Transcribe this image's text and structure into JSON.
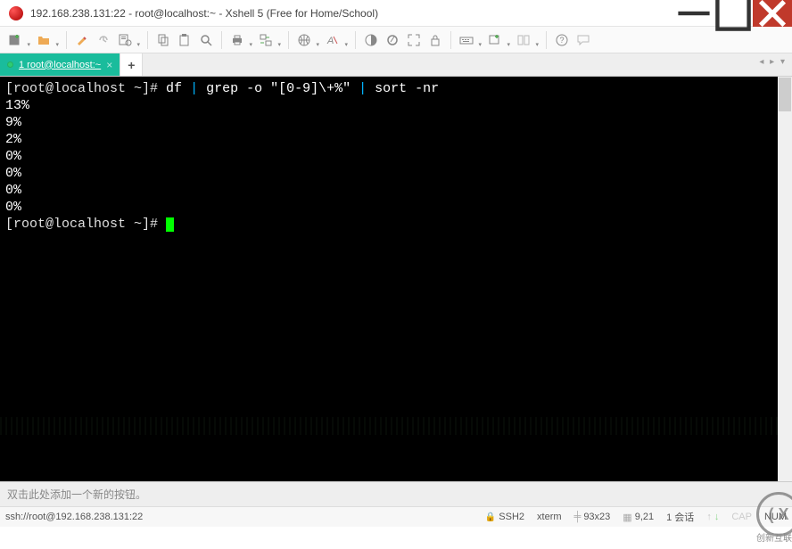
{
  "window": {
    "title": "192.168.238.131:22 - root@localhost:~ - Xshell 5 (Free for Home/School)"
  },
  "tabs": [
    {
      "label": "1 root@localhost:~",
      "active": true
    }
  ],
  "terminal": {
    "prompt": "[root@localhost ~]#",
    "command_parts": {
      "c1": "df ",
      "p1": "|",
      "c2": " grep -o \"[0-9]\\+%\" ",
      "p2": "|",
      "c3": " sort -nr"
    },
    "output": [
      "13%",
      "9%",
      "2%",
      "0%",
      "0%",
      "0%",
      "0%"
    ],
    "prompt2": "[root@localhost ~]#"
  },
  "buttonbar_hint": "双击此处添加一个新的按钮。",
  "status": {
    "conn": "ssh://root@192.168.238.131:22",
    "ssh": "SSH2",
    "term": "xterm",
    "size": "93x23",
    "cursor": "9,21",
    "sessions": "1 会话",
    "caps": "CAP",
    "num": "NUM"
  },
  "watermark_text": "创新互联"
}
